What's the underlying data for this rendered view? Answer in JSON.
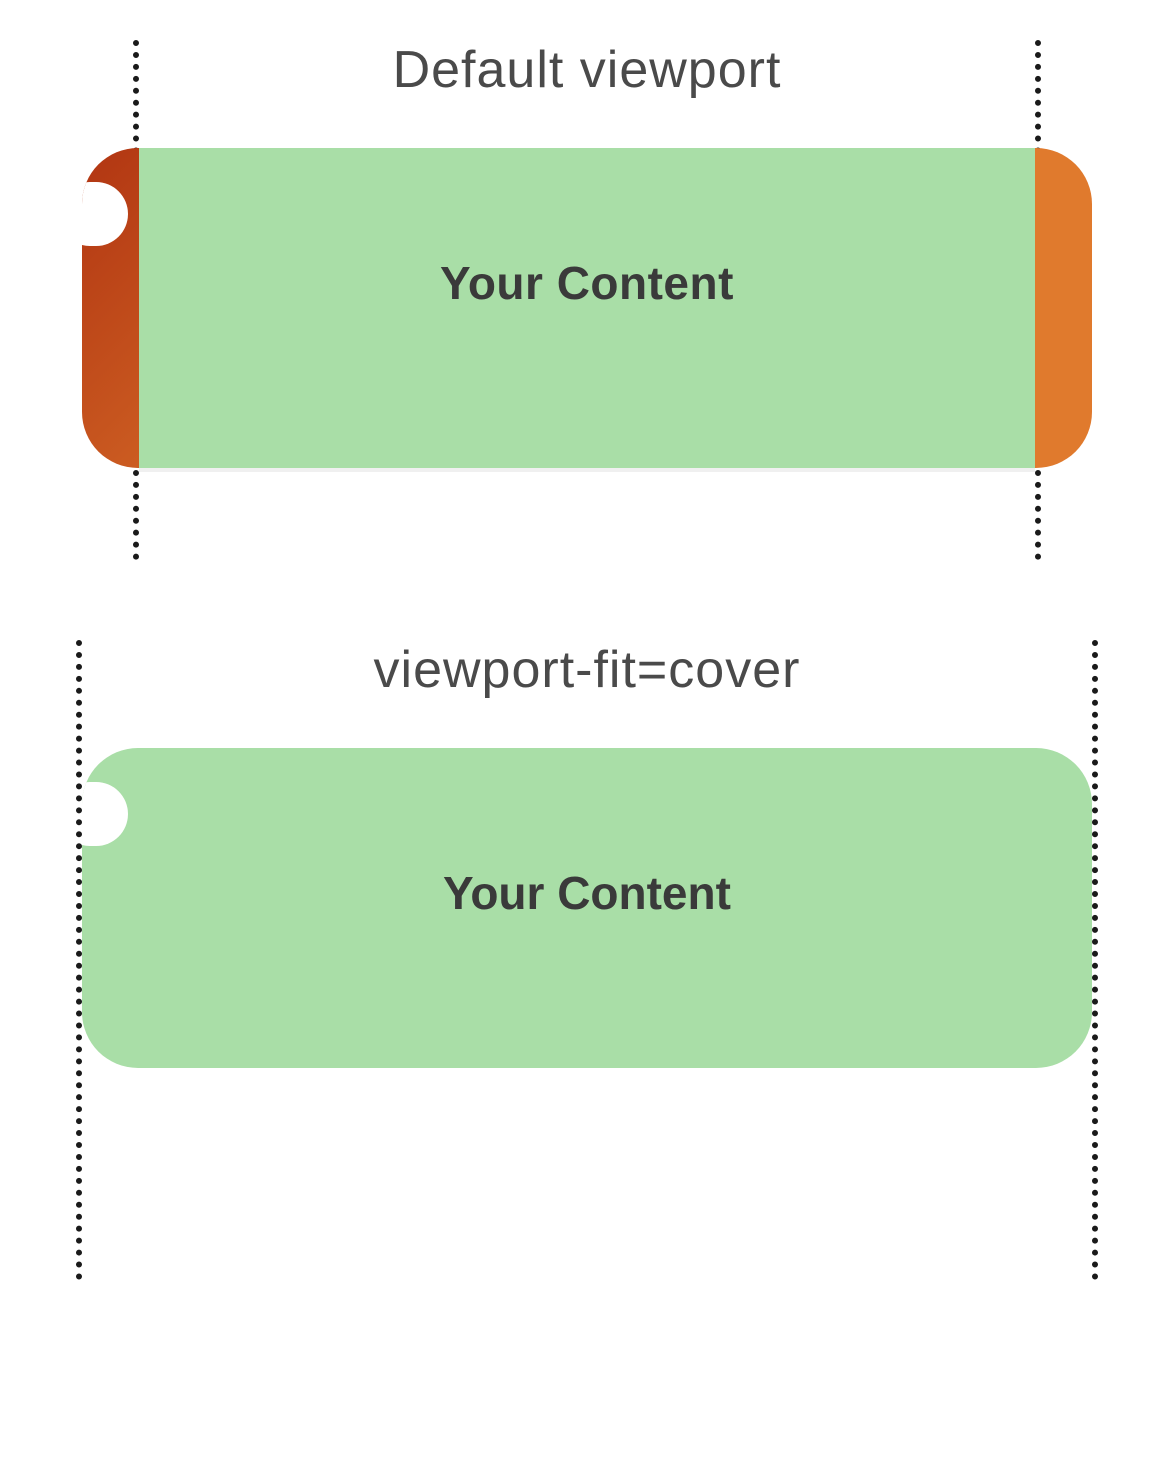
{
  "sections": {
    "default": {
      "title": "Default viewport",
      "content_label": "Your Content"
    },
    "cover": {
      "title": "viewport-fit=cover",
      "content_label": "Your Content"
    }
  },
  "colors": {
    "content_background": "#a9dea7",
    "device_unsafe_background_start": "#b13512",
    "device_unsafe_background_end": "#e07a2d",
    "text_color": "#3a3a3a",
    "guide_line_color": "#1a1a1a"
  }
}
